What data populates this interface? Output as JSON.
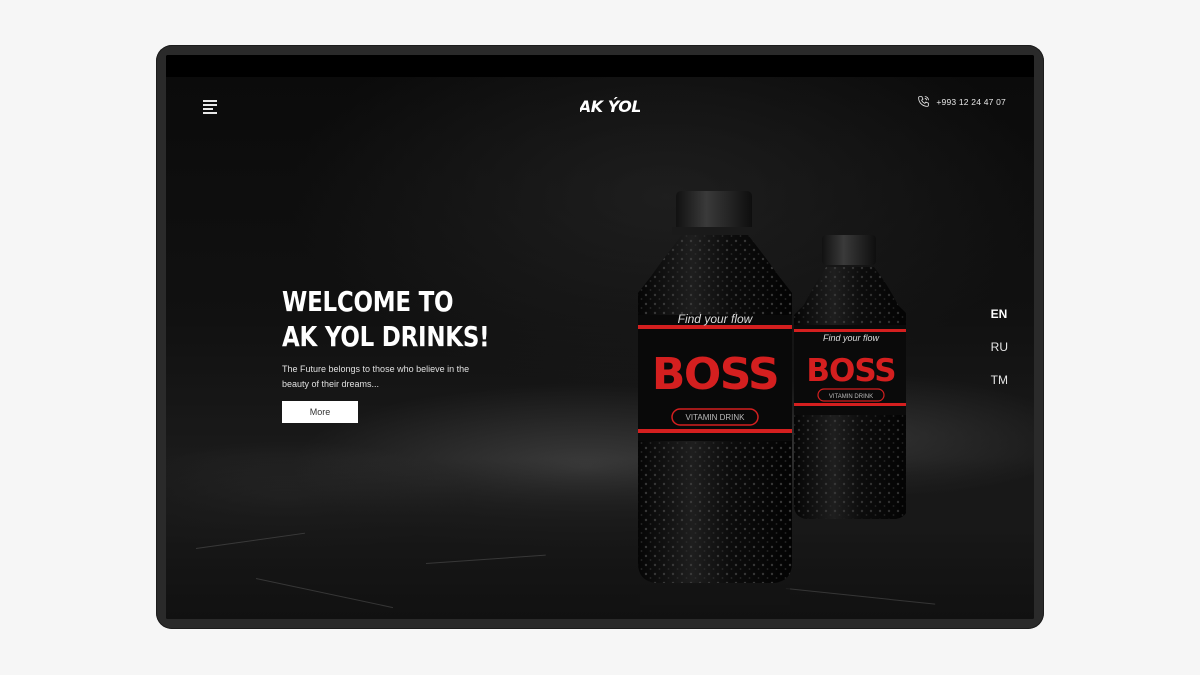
{
  "header": {
    "logo_text": "AK ÝOL",
    "phone": "+993 12 24 47 07"
  },
  "hero": {
    "title_line1": "WELCOME TO",
    "title_line2": "AK YOL DRINKS!",
    "tagline": "The Future belongs to those who believe in the beauty of their dreams...",
    "button_label": "More"
  },
  "product": {
    "slogan": "Find your flow",
    "brand": "BOSS",
    "subtitle": "VITAMIN DRINK"
  },
  "languages": [
    {
      "code": "EN",
      "active": true
    },
    {
      "code": "RU",
      "active": false
    },
    {
      "code": "TM",
      "active": false
    }
  ],
  "colors": {
    "accent_red": "#d41f1f",
    "background": "#060606",
    "text": "#ffffff"
  },
  "icons": {
    "menu": "hamburger-menu-icon",
    "phone": "phone-icon"
  }
}
